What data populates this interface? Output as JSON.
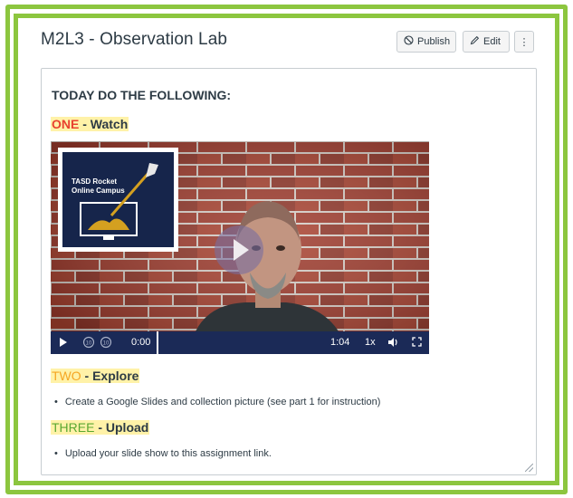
{
  "page": {
    "title": "M2L3 - Observation Lab"
  },
  "toolbar": {
    "publish_label": "Publish",
    "edit_label": "Edit",
    "more_label": "⋮"
  },
  "content": {
    "heading": "TODAY DO THE FOLLOWING:",
    "steps": [
      {
        "number": "ONE",
        "action": " - Watch"
      },
      {
        "number": "TWO",
        "action": " - Explore"
      },
      {
        "number": "THREE",
        "action": " - Upload"
      }
    ],
    "bullets": [
      "Create a Google Slides and collection picture (see part 1 for instruction)",
      "Upload your slide show to this assignment link."
    ]
  },
  "video": {
    "logo_line1": "TASD Rocket",
    "logo_line2": "Online Campus",
    "current_time": "0:00",
    "duration": "1:04",
    "playback_speed": "1x",
    "progress": 0
  },
  "colors": {
    "frame_green": "#8cc63f",
    "step_one_red": "#e8412f",
    "step_two_yellow": "#f5a623",
    "step_three_green": "#5aa832",
    "highlight": "#fff2a8",
    "video_controls_bg": "#1b2a57"
  },
  "icons": {
    "publish": "no-entry-icon",
    "edit": "pencil-icon",
    "more": "vertical-dots-icon",
    "play": "play-icon",
    "rewind": "rewind-10-icon",
    "forward": "forward-10-icon",
    "volume": "volume-icon",
    "fullscreen": "fullscreen-icon"
  }
}
